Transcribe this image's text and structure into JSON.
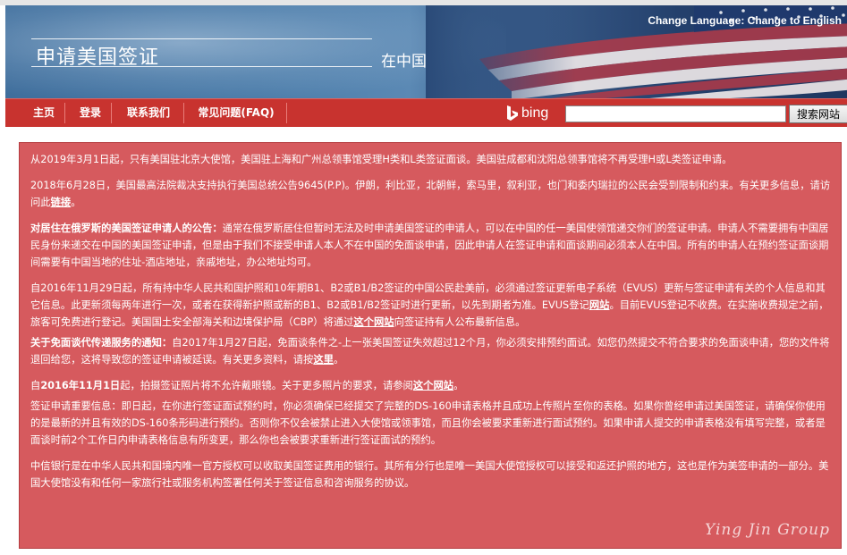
{
  "header": {
    "title": "申请美国签证",
    "subtitle": "在中国",
    "lang_prefix": "Change Language: ",
    "lang_link": "Change to English"
  },
  "nav": {
    "items": [
      {
        "label": "主页"
      },
      {
        "label": "登录"
      },
      {
        "label": "联系我们"
      },
      {
        "label": "常见问题(FAQ)"
      }
    ],
    "search_brand": "bing",
    "search_value": "",
    "search_button": "搜索网站"
  },
  "notices": {
    "p1": "从2019年3月1日起，只有美国驻北京大使馆，美国驻上海和广州总领事馆受理H类和L类签证面谈。美国驻成都和沈阳总领事馆将不再受理H或L类签证申请。",
    "p2_text": "2018年6月28日，美国最高法院裁决支持执行美国总统公告9645(P.P)。伊朗，利比亚，北朝鲜，索马里，叙利亚，也门和委内瑞拉的公民会受到限制和约束。有关更多信息，请访问此",
    "p2_link": "链接",
    "p2_end": "。",
    "p3_title": "对居住在俄罗斯的美国签证申请人的公告：",
    "p3_text": "通常在俄罗斯居住但暂时无法及时申请美国签证的申请人，可以在中国的任一美国使领馆递交你们的签证申请。申请人不需要拥有中国居民身份来递交在中国的美国签证申请，但是由于我们不接受申请人本人不在中国的免面谈申请，因此申请人在签证申请和面谈期间必须本人在中国。所有的申请人在预约签证面谈期间需要有中国当地的住址-酒店地址，亲戚地址，办公地址均可。",
    "p4_text1": "自2016年11月29日起，所有持中华人民共和国护照和10年期B1、B2或B1/B2签证的中国公民赴美前，必须通过签证更新电子系统（EVUS）更新与签证申请有关的个人信息和其它信息。此更新须每两年进行一次，或者在获得新护照或新的B1、B2或B1/B2签证时进行更新，以先到期者为准。EVUS登记",
    "p4_link1": "网站",
    "p4_text2": "。目前EVUS登记不收费。在实施收费规定之前，旅客可免费进行登记。美国国土安全部海关和边境保护局（CBP）将通过",
    "p4_link2": "这个网站",
    "p4_text3": "向签证持有人公布最新信息。",
    "p5_title": "关于免面谈代传递服务的通知：",
    "p5_text": "自2017年1月27日起，免面谈条件之-上一张美国签证失效超过12个月，你必须安排预约面试。如您仍然提交不符合要求的免面谈申请，您的文件将退回给您，这将导致您的签证申请被延误。有关更多资料，请按",
    "p5_link": "这里",
    "p5_end": "。",
    "p6_pre": "自",
    "p6_date": "2016年11月1日",
    "p6_text": "起，拍摄签证照片将不允许戴眼镜。关于更多照片的要求，请参阅",
    "p6_link": "这个网站",
    "p6_end": "。",
    "p7": "签证申请重要信息：即日起，在你进行签证面试预约时，你必须确保已经提交了完整的DS-160申请表格并且成功上传照片至你的表格。如果你曾经申请过美国签证，请确保你使用的是最新的并且有效的DS-160条形码进行预约。否则你不仅会被禁止进入大使馆或领事馆，而且你会被要求重新进行面试预约。如果申请人提交的申请表格没有填写完整，或者是面谈时前2个工作日内申请表格信息有所变更，那么你也会被要求重新进行签证面试的预约。",
    "p8": "中信银行是在中华人民共和国境内唯一官方授权可以收取美国签证费用的银行。其所有分行也是唯一美国大使馆授权可以接受和返还护照的地方，这也是作为美签申请的一部分。美国大使馆没有和任何一家旅行社或服务机构签署任何关于签证信息和咨询服务的协议。"
  },
  "footer": {
    "logo_text": "Ying Jin Group"
  },
  "colors": {
    "nav_red": "#c8332f",
    "notice_bg": "#d65a5e",
    "banner_blue": "#3f6e9c"
  }
}
